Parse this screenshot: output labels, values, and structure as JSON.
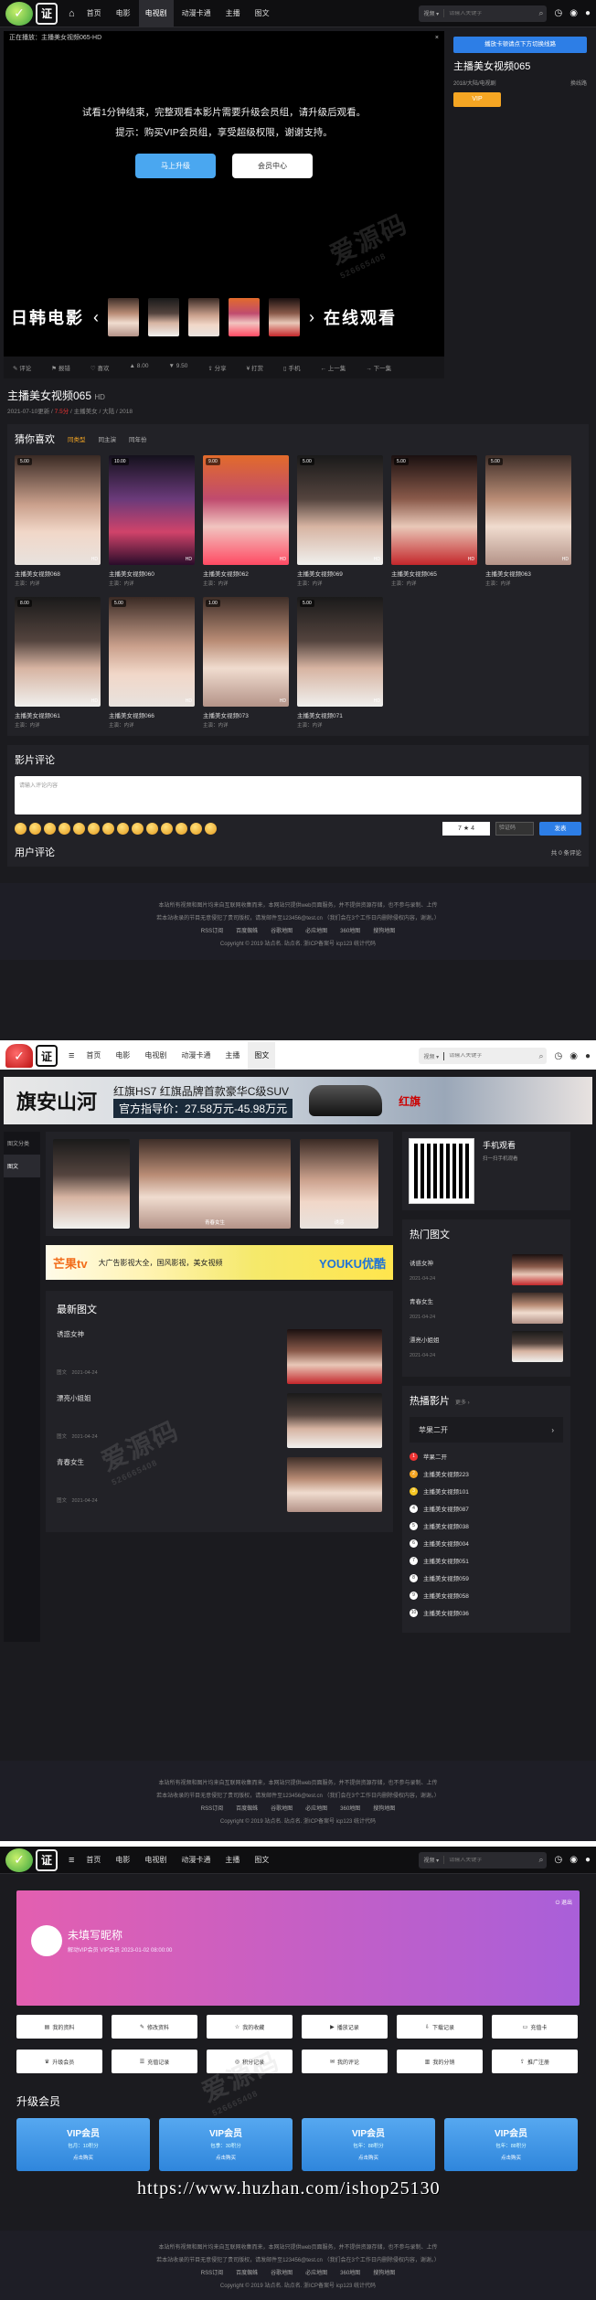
{
  "nav": {
    "items": [
      "首页",
      "电影",
      "电视剧",
      "动漫卡通",
      "主播",
      "图文"
    ],
    "search_select": "视频",
    "search_placeholder": "请输入关键字"
  },
  "player": {
    "now_playing": "正在播放：主播美女视频065-HD",
    "close": "×",
    "msg1": "试看1分钟结束，完整观看本影片需要升级会员组，请升级后观看。",
    "msg2": "提示：购买VIP会员组，享受超级权限，谢谢支持。",
    "btn_upgrade": "马上升级",
    "btn_center": "会员中心",
    "ad_left": "日韩电影",
    "ad_right": "在线观看",
    "foot": [
      "评论",
      "报错",
      "喜欢",
      "8.00",
      "9.50",
      "分享",
      "打赏",
      "手机",
      "上一集",
      "下一集"
    ]
  },
  "side": {
    "phone_btn": "播放卡顿请点下方切换线路",
    "title": "主播美女视频065",
    "meta_left": "2018/大陆/电视剧",
    "meta_right": "换线路",
    "vip": "VIP"
  },
  "video": {
    "title": "主播美女视频065",
    "hd": "HD",
    "date": "2021-07-10更新",
    "score": "7.5分",
    "cat": "主播美女",
    "area": "大陆",
    "year": "2018"
  },
  "guess": {
    "title": "猜你喜欢",
    "tabs": [
      "同类型",
      "同主演",
      "同年份"
    ],
    "cards": [
      {
        "tag": "5.00",
        "name": "主播美女视频068",
        "sub": "主演：内详"
      },
      {
        "tag": "10.00",
        "name": "主播美女视频060",
        "sub": "主演：内详"
      },
      {
        "tag": "9.00",
        "name": "主播美女视频062",
        "sub": "主演：内详"
      },
      {
        "tag": "5.00",
        "name": "主播美女视频069",
        "sub": "主演：内详"
      },
      {
        "tag": "5.00",
        "name": "主播美女视频065",
        "sub": "主演：内详"
      },
      {
        "tag": "5.00",
        "name": "主播美女视频063",
        "sub": "主演：内详"
      },
      {
        "tag": "8.00",
        "name": "主播美女视频061",
        "sub": "主演：内详"
      },
      {
        "tag": "5.00",
        "name": "主播美女视频066",
        "sub": "主演：内详"
      },
      {
        "tag": "1.00",
        "name": "主播美女视频073",
        "sub": "主演：内详"
      },
      {
        "tag": "5.00",
        "name": "主播美女视频071",
        "sub": "主演：内详"
      }
    ],
    "hd": "HD"
  },
  "comments": {
    "title": "影片评论",
    "placeholder": "请输入评论内容",
    "captcha": "7 ★ 4",
    "captcha_placeholder": "验证码",
    "send": "发表",
    "user_title": "用户评论",
    "count": "共 0 条评论"
  },
  "footer": {
    "line1": "本站所有视频和图片均来自互联网收集而来，本网站只提供web页面服务，并不提供资源存储，也不参与录制、上传",
    "line2": "若本站收录的节目无意侵犯了贵司版权，请发邮件至123456@test.cn （我们会在3个工作日内删除侵权内容，谢谢。）",
    "links": [
      "RSS订阅",
      "百度蜘蛛",
      "谷歌地图",
      "必应地图",
      "360地图",
      "搜狗地图"
    ],
    "copyright": "Copyright © 2019 站点名. 站点名. 浙ICP备案号 icp123 统计代码"
  },
  "shot2": {
    "banner_brand": "旗安山河",
    "banner_text1": "红旗HS7 红旗品牌首款豪华C级SUV",
    "banner_text2": "官方指导价：27.58万元-45.98万元",
    "banner_hq": "红旗",
    "left_items": [
      "图文分类",
      "图文"
    ],
    "pics": [
      "",
      "青春女生",
      "诱惑"
    ],
    "ad_left": "芒果tv",
    "ad_mid": "大广告影视大全，国风影视，美女视频",
    "ad_right": "YOUKU优酷",
    "news_title": "最新图文",
    "news": [
      {
        "title": "诱惑女神",
        "date": "图文　2021-04-24"
      },
      {
        "title": "漂亮小姐姐",
        "date": "图文　2021-04-24"
      },
      {
        "title": "青春女生",
        "date": "图文　2021-04-24"
      }
    ],
    "qr_title": "手机观看",
    "qr_sub": "扫一扫手机观看",
    "hot_title": "热门图文",
    "hot": [
      {
        "title": "诱惑女神",
        "date": "2021-04-24"
      },
      {
        "title": "青春女生",
        "date": "2021-04-24"
      },
      {
        "title": "漂亮小姐姐",
        "date": "2021-04-24"
      }
    ],
    "rank_title": "热播影片",
    "rank_more": "更多 ›",
    "rank_select": "苹果二开",
    "rank": [
      "苹果二开",
      "主播美女视频223",
      "主播美女视频101",
      "主播美女视频087",
      "主播美女视频038",
      "主播美女视频004",
      "主播美女视频051",
      "主播美女视频059",
      "主播美女视频058",
      "主播美女视频036"
    ]
  },
  "shot3": {
    "nick": "未填写昵称",
    "info": "解动VIP会员 VIP会员 2023-01-02 08:00:00",
    "logout": "退出",
    "buttons": [
      "我的资料",
      "修改资料",
      "我的收藏",
      "播放记录",
      "下载记录",
      "充值卡",
      "升级会员",
      "充值记录",
      "积分记录",
      "我的评论",
      "我的分销",
      "推广注册"
    ],
    "upgrade_title": "升级会员",
    "vip_cards": [
      {
        "title": "VIP会员",
        "price": "包月：10积分",
        "buy": "点击购买"
      },
      {
        "title": "VIP会员",
        "price": "包季：30积分",
        "buy": "点击购买"
      },
      {
        "title": "VIP会员",
        "price": "包年：88积分",
        "buy": "点击购买"
      },
      {
        "title": "VIP会员",
        "price": "包年：88积分",
        "buy": "点击购买"
      }
    ]
  },
  "watermark": {
    "cn": "爱源码",
    "num": "526665408"
  },
  "huzhan": "https://www.huzhan.com/ishop25130"
}
